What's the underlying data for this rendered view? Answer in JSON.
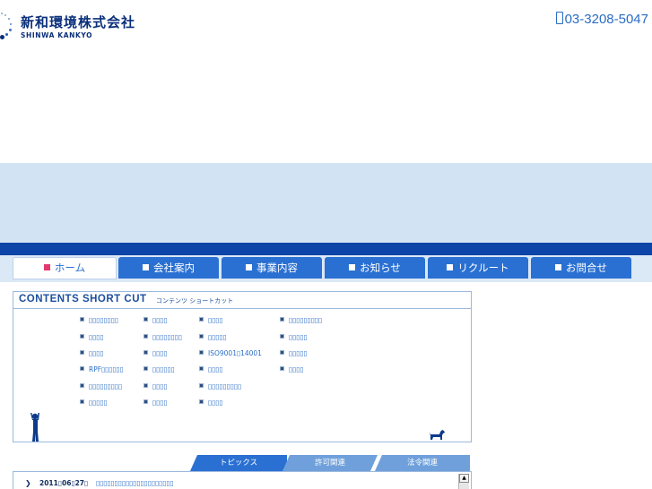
{
  "header": {
    "logo_jp": "新和環境株式会社",
    "logo_en": "SHINWA KANKYO",
    "phone": "03-3208-5047"
  },
  "nav": {
    "tabs": [
      {
        "label": "ホーム",
        "active": true
      },
      {
        "label": "会社案内",
        "active": false
      },
      {
        "label": "事業内容",
        "active": false
      },
      {
        "label": "お知らせ",
        "active": false
      },
      {
        "label": "リクルート",
        "active": false
      },
      {
        "label": "お問合せ",
        "active": false
      }
    ]
  },
  "shortcut": {
    "title": "CONTENTS SHORT CUT",
    "subtitle": "コンテンツ ショートカット",
    "links": [
      [
        "▯▯▯▯▯▯▯▯",
        "▯▯▯▯",
        "▯▯▯▯",
        "▯▯▯▯▯▯▯▯▯"
      ],
      [
        "▯▯▯▯",
        "▯▯▯▯▯▯▯▯",
        "▯▯▯▯▯",
        "▯▯▯▯▯"
      ],
      [
        "▯▯▯▯",
        "▯▯▯▯",
        "ISO9001▯14001",
        "▯▯▯▯▯"
      ],
      [
        "RPF▯▯▯▯▯▯",
        "▯▯▯▯▯▯",
        "▯▯▯▯",
        "▯▯▯▯"
      ],
      [
        "▯▯▯▯▯▯▯▯▯",
        "▯▯▯▯",
        "▯▯▯▯▯▯▯▯▯",
        ""
      ],
      [
        "▯▯▯▯▯",
        "▯▯▯▯",
        "▯▯▯▯",
        ""
      ]
    ]
  },
  "topics": {
    "tabs": [
      "トピックス",
      "許可関連",
      "法令関連"
    ],
    "items": [
      {
        "date": "2011▯06▯27▯",
        "title": "▯▯▯▯▯▯▯▯▯▯▯▯▯▯▯▯▯▯▯▯▯"
      }
    ]
  },
  "colors": {
    "brand": "#0a2f7a",
    "nav_tab": "#2a70d2",
    "nav_band": "#0d44a8",
    "hero": "#d2e3f4",
    "active_marker": "#e23a6e"
  }
}
